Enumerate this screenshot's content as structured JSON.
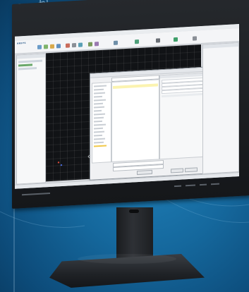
{
  "scene": {
    "background_color": "#15689d",
    "monitor_color": "#1b1d20"
  },
  "app": {
    "ribbon_logo": "ANSYS",
    "left_panel_title": "",
    "right_panel_title": "",
    "dialog_title": "",
    "selected_file": ""
  }
}
